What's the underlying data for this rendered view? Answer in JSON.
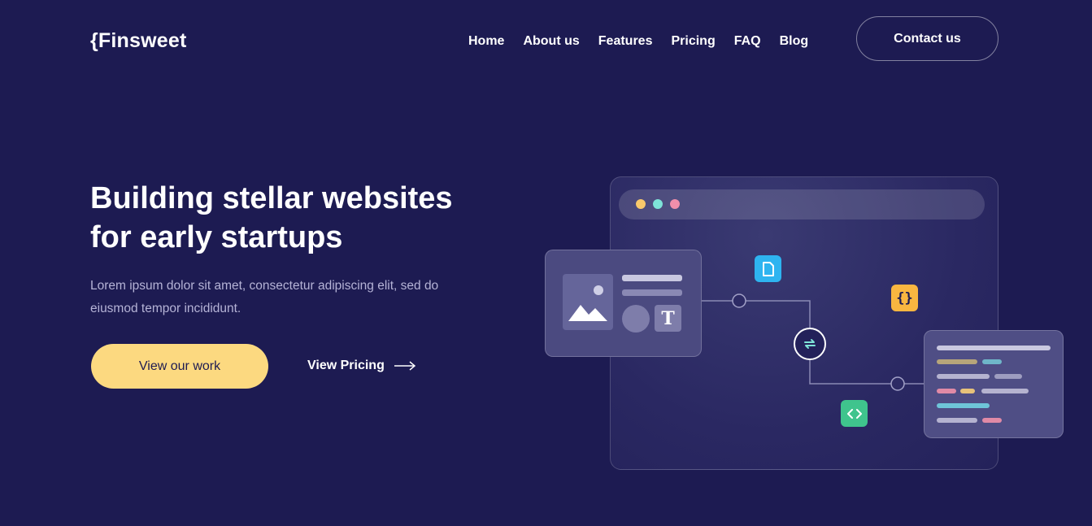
{
  "brand": {
    "logo": "{Finsweet"
  },
  "nav": {
    "items": [
      "Home",
      "About us",
      "Features",
      "Pricing",
      "FAQ",
      "Blog"
    ],
    "contact_label": "Contact us"
  },
  "hero": {
    "title_line1": "Building stellar websites",
    "title_line2": "for early startups",
    "description": "Lorem ipsum dolor sit amet, consectetur adipiscing elit, sed do eiusmod tempor incididunt.",
    "primary_cta": "View our work",
    "secondary_cta": "View Pricing"
  },
  "illustration": {
    "braces_glyph": "{}",
    "text_glyph": "T"
  },
  "colors": {
    "background": "#1d1b52",
    "accent_yellow": "#fcd980",
    "dot_yellow": "#f9c96b",
    "dot_teal": "#7ee3d8",
    "dot_pink": "#f08fab",
    "chip_blue": "#2eb4f0",
    "chip_orange": "#f9b640",
    "chip_green": "#3fc48d"
  }
}
